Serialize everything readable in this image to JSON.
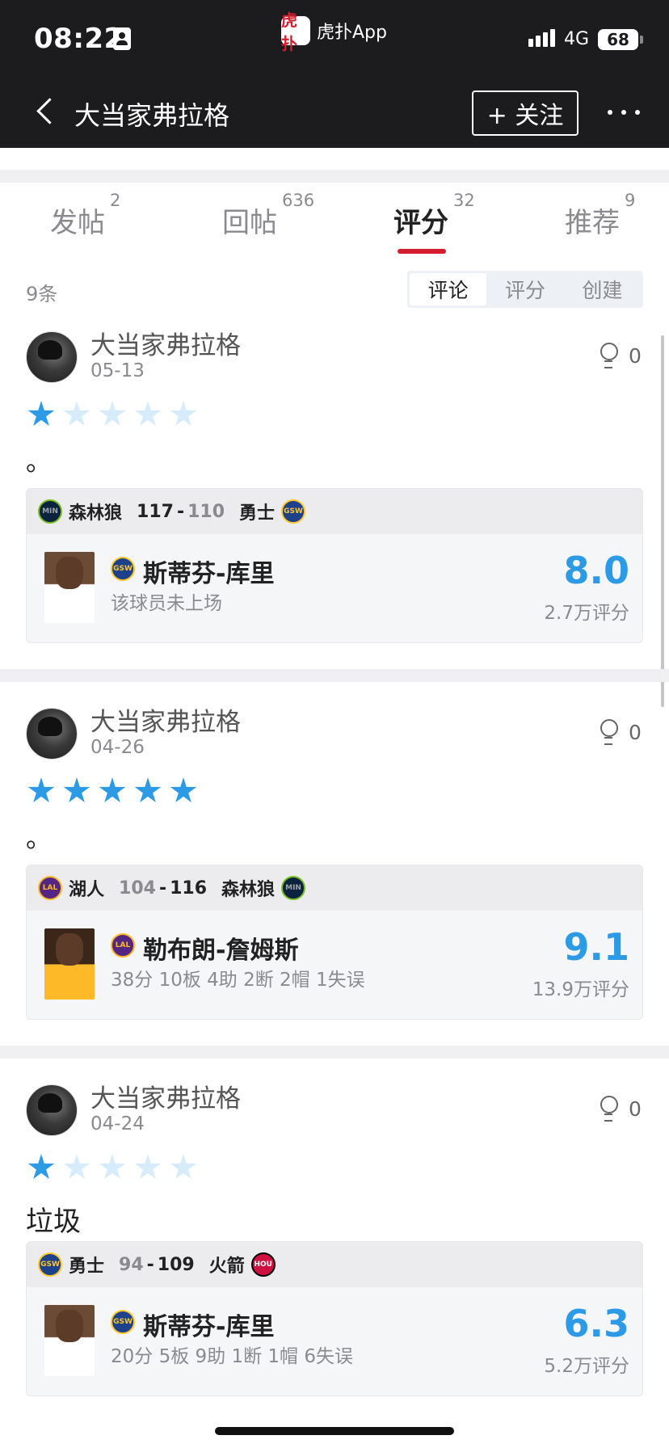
{
  "status_bar": {
    "time": "08:22",
    "app_name": "虎扑App",
    "app_icon_text": "虎扑",
    "network": "4G",
    "battery": "68"
  },
  "nav": {
    "title": "大当家弗拉格",
    "follow_label": "+ 关注"
  },
  "tabs": [
    {
      "label": "发帖",
      "count": "2"
    },
    {
      "label": "回帖",
      "count": "636"
    },
    {
      "label": "评分",
      "count": "32"
    },
    {
      "label": "推荐",
      "count": "9"
    }
  ],
  "active_tab": "评分",
  "count_label": "9条",
  "segments": [
    "评论",
    "评分",
    "创建"
  ],
  "active_segment": "评论",
  "colors": {
    "accent_red": "#d41d2f",
    "rating_blue": "#2d9ae6",
    "topbar": "#1c1c1f"
  },
  "posts": [
    {
      "user": "大当家弗拉格",
      "date": "05-13",
      "likes": "0",
      "stars": 1,
      "text": "。",
      "game": {
        "team_a": "森林狼",
        "team_a_logo": "MIN",
        "score_a": "117",
        "score_b": "110",
        "team_b": "勇士",
        "team_b_logo": "GSW"
      },
      "player": {
        "name": "斯蒂芬-库里",
        "team_logo": "GSW",
        "stat": "该球员未上场",
        "rating": "8.0",
        "rating_count": "2.7万评分"
      }
    },
    {
      "user": "大当家弗拉格",
      "date": "04-26",
      "likes": "0",
      "stars": 5,
      "text": "。",
      "game": {
        "team_a": "湖人",
        "team_a_logo": "LAL",
        "score_a": "104",
        "score_b": "116",
        "team_b": "森林狼",
        "team_b_logo": "MIN"
      },
      "player": {
        "name": "勒布朗-詹姆斯",
        "team_logo": "LAL",
        "stat": "38分 10板 4助 2断 2帽 1失误",
        "rating": "9.1",
        "rating_count": "13.9万评分"
      }
    },
    {
      "user": "大当家弗拉格",
      "date": "04-24",
      "likes": "0",
      "stars": 1,
      "text": "垃圾",
      "game": {
        "team_a": "勇士",
        "team_a_logo": "GSW",
        "score_a": "94",
        "score_b": "109",
        "team_b": "火箭",
        "team_b_logo": "HOU"
      },
      "player": {
        "name": "斯蒂芬-库里",
        "team_logo": "GSW",
        "stat": "20分 5板 9助 1断 1帽 6失误",
        "rating": "6.3",
        "rating_count": "5.2万评分"
      }
    }
  ]
}
